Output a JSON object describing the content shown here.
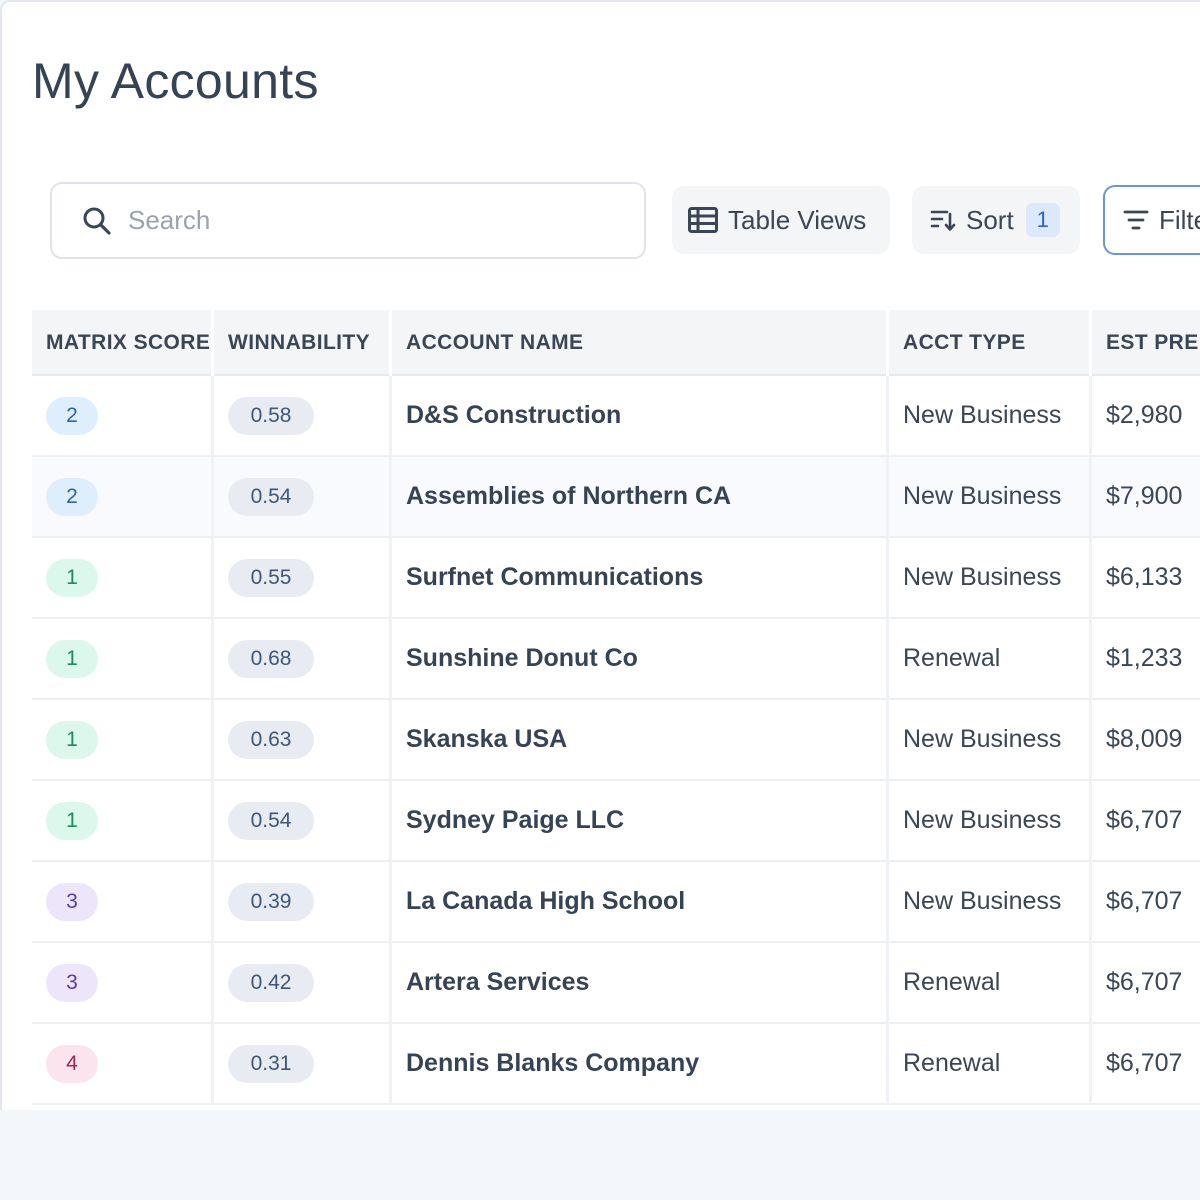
{
  "page": {
    "title": "My Accounts"
  },
  "toolbar": {
    "search_placeholder": "Search",
    "table_views_label": "Table Views",
    "sort_label": "Sort",
    "sort_count": "1",
    "filter_label": "Filte"
  },
  "table": {
    "headers": [
      "MATRIX SCORE",
      "WINNABILITY",
      "ACCOUNT NAME",
      "ACCT TYPE",
      "EST PRE"
    ],
    "rows": [
      {
        "score": "2",
        "winnability": "0.58",
        "name": "D&S Construction",
        "type": "New Business",
        "est": "$2,980"
      },
      {
        "score": "2",
        "winnability": "0.54",
        "name": "Assemblies of Northern CA",
        "type": "New Business",
        "est": "$7,900"
      },
      {
        "score": "1",
        "winnability": "0.55",
        "name": "Surfnet Communications",
        "type": "New Business",
        "est": "$6,133"
      },
      {
        "score": "1",
        "winnability": "0.68",
        "name": "Sunshine Donut Co",
        "type": "Renewal",
        "est": "$1,233"
      },
      {
        "score": "1",
        "winnability": "0.63",
        "name": "Skanska USA",
        "type": "New Business",
        "est": "$8,009"
      },
      {
        "score": "1",
        "winnability": "0.54",
        "name": "Sydney Paige LLC",
        "type": "New Business",
        "est": "$6,707"
      },
      {
        "score": "3",
        "winnability": "0.39",
        "name": "La Canada High School",
        "type": "New Business",
        "est": "$6,707"
      },
      {
        "score": "3",
        "winnability": "0.42",
        "name": "Artera Services",
        "type": "Renewal",
        "est": "$6,707"
      },
      {
        "score": "4",
        "winnability": "0.31",
        "name": "Dennis Blanks Company",
        "type": "Renewal",
        "est": "$6,707"
      }
    ]
  },
  "score_colors": {
    "1": {
      "bg": "#dcf7ec",
      "fg": "#1f8a5e"
    },
    "2": {
      "bg": "#dfeefc",
      "fg": "#2d62b0"
    },
    "3": {
      "bg": "#ede6fb",
      "fg": "#5b3aa8"
    },
    "4": {
      "bg": "#fce4ee",
      "fg": "#a3264f"
    }
  },
  "icons": {
    "search": "search-icon",
    "table_views": "table-icon",
    "sort": "sort-icon",
    "filter": "filter-icon"
  }
}
